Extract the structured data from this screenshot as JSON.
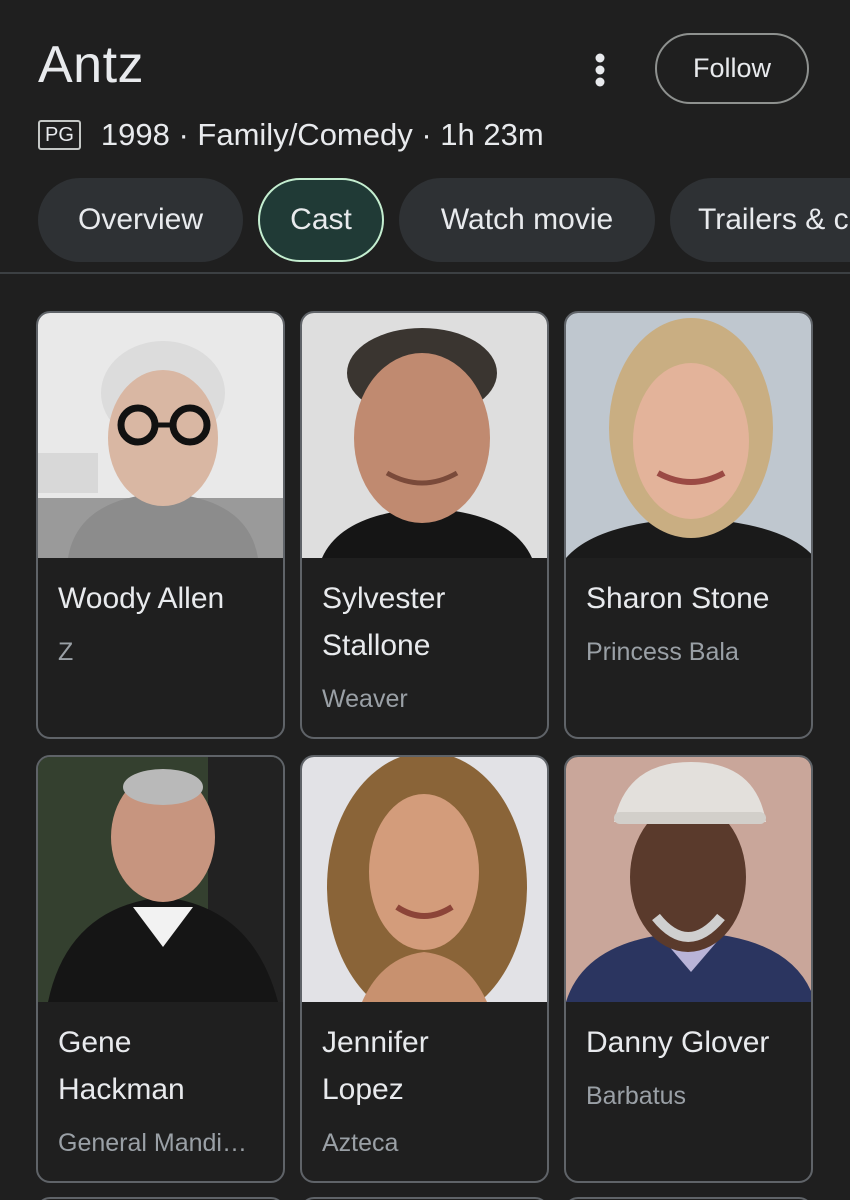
{
  "header": {
    "title": "Antz",
    "follow_label": "Follow",
    "menu_icon": "more-vert-icon"
  },
  "meta": {
    "rating": "PG",
    "info": "1998 · Family/Comedy · 1h 23m"
  },
  "tabs": [
    {
      "label": "Overview",
      "active": false
    },
    {
      "label": "Cast",
      "active": true
    },
    {
      "label": "Watch movie",
      "active": false
    },
    {
      "label": "Trailers & clips",
      "active": false
    }
  ],
  "cast": [
    {
      "name_line1": "Woody Allen",
      "name_line2": "",
      "role": "Z"
    },
    {
      "name_line1": "Sylvester",
      "name_line2": "Stallone",
      "role": "Weaver"
    },
    {
      "name_line1": "Sharon Stone",
      "name_line2": "",
      "role": "Princess Bala"
    },
    {
      "name_line1": "Gene",
      "name_line2": "Hackman",
      "role": "General Mandi…"
    },
    {
      "name_line1": "Jennifer",
      "name_line2": "Lopez",
      "role": "Azteca"
    },
    {
      "name_line1": "Danny Glover",
      "name_line2": "",
      "role": "Barbatus"
    }
  ],
  "colors": {
    "background": "#1f1f1f",
    "tab_bg": "#2e3134",
    "tab_active_bg": "#203a36",
    "tab_active_border": "#c4eed0",
    "text_primary": "#e8eaed",
    "text_secondary": "#9aa0a6",
    "card_border": "#5f6368"
  }
}
